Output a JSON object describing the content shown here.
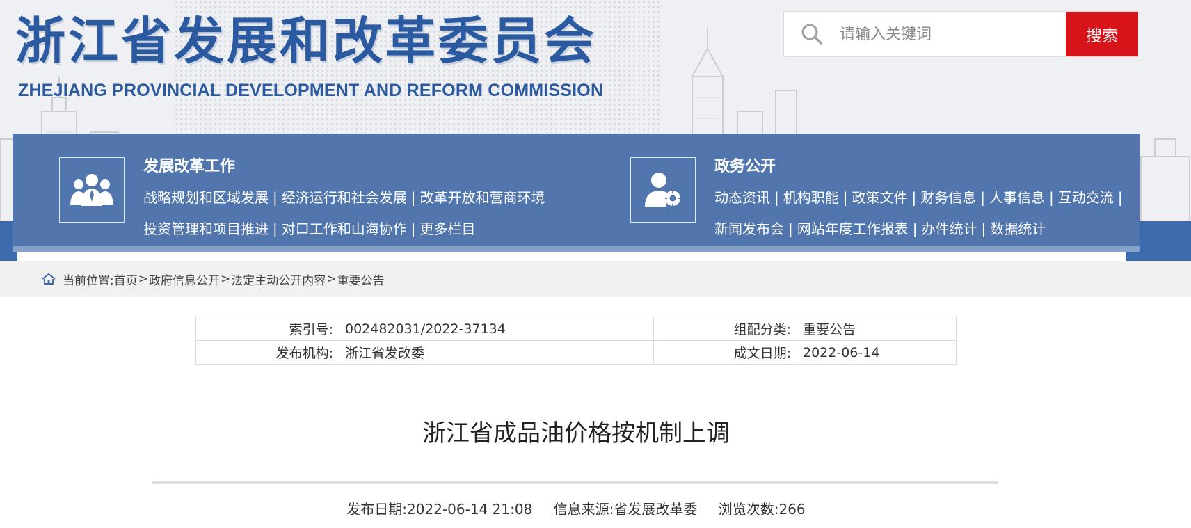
{
  "header": {
    "logo_cn": "浙江省发展和改革委员会",
    "logo_en": "ZHEJIANG PROVINCIAL DEVELOPMENT AND REFORM COMMISSION",
    "search_placeholder": "请输入关键词",
    "search_button": "搜索"
  },
  "nav": {
    "groups": [
      {
        "title": "发展改革工作",
        "icon": "people-group-icon",
        "links": [
          "战略规划和区域发展",
          "经济运行和社会发展",
          "改革开放和营商环境",
          "投资管理和项目推进",
          "对口工作和山海协作",
          "更多栏目"
        ]
      },
      {
        "title": "政务公开",
        "icon": "user-gear-icon",
        "links": [
          "动态资讯",
          "机构职能",
          "政策文件",
          "财务信息",
          "人事信息",
          "互动交流",
          "新闻发布会",
          "网站年度工作报表",
          "办件统计",
          "数据统计"
        ]
      }
    ],
    "separator": "|"
  },
  "breadcrumb": {
    "prefix": "当前位置:",
    "items": [
      "首页",
      "政府信息公开",
      "法定主动公开内容",
      "重要公告"
    ],
    "arrow": ">"
  },
  "meta": {
    "index_label": "索引号:",
    "index_value": "002482031/2022-37134",
    "category_label": "组配分类:",
    "category_value": "重要公告",
    "publisher_label": "发布机构:",
    "publisher_value": "浙江省发改委",
    "date_label": "成文日期:",
    "date_value": "2022-06-14"
  },
  "article": {
    "title": "浙江省成品油价格按机制上调",
    "publish_date": "发布日期:2022-06-14 21:08",
    "source": "信息来源:省发展改革委",
    "views": "浏览次数:266"
  },
  "colors": {
    "brand_blue": "#2c5aa0",
    "nav_blue": "#5176ae",
    "search_red": "#d7141a"
  }
}
